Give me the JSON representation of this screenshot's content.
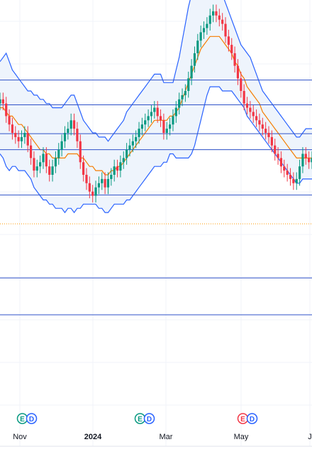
{
  "chart_data": {
    "type": "candlestick",
    "title": "",
    "x_ticks": [
      {
        "label": "Nov",
        "bold": false
      },
      {
        "label": "2024",
        "bold": true
      },
      {
        "label": "Mar",
        "bold": false
      },
      {
        "label": "May",
        "bold": false
      },
      {
        "label": "J",
        "bold": false
      }
    ],
    "ylim": [
      0,
      100
    ],
    "grid": true,
    "colors": {
      "up": "#089981",
      "down": "#f23645",
      "band": "#2962ff",
      "band_fill": "#eef4fc",
      "ma": "#f57c00",
      "hline": "#2f52c8",
      "grid": "#f0f3fa",
      "dotted": "#ff9800"
    },
    "levels": [
      82.6,
      76.7,
      69.8,
      66.0,
      55.2
    ],
    "lower_levels": [
      35.4,
      26.6
    ],
    "dotted_level": 48.3,
    "closes": [
      78,
      77,
      74,
      72,
      70,
      69,
      68,
      69,
      70,
      67,
      64,
      61,
      62,
      63,
      65,
      62,
      60,
      62,
      64,
      66,
      68,
      70,
      71,
      73,
      71,
      68,
      63,
      60,
      58,
      56,
      55,
      57,
      58,
      59,
      57,
      59,
      60,
      62,
      61,
      63,
      64,
      66,
      67,
      68,
      69,
      71,
      72,
      73,
      74,
      75,
      76,
      74,
      73,
      70,
      71,
      72,
      74,
      76,
      78,
      79,
      80,
      83,
      86,
      89,
      92,
      94,
      95,
      96,
      98,
      99,
      98,
      97,
      96,
      93,
      91,
      89,
      86,
      83,
      80,
      77,
      76,
      75,
      74,
      73,
      72,
      71,
      70,
      69,
      67,
      65,
      64,
      62,
      61,
      60,
      59,
      58,
      59,
      62,
      65,
      64,
      63,
      64
    ],
    "bollinger": {
      "upper": [
        87,
        88,
        89,
        87,
        85,
        84,
        83,
        82,
        81,
        80,
        80,
        79,
        79,
        78,
        78,
        77,
        77,
        76,
        76,
        76,
        76,
        77,
        78,
        79,
        79,
        77,
        75,
        73,
        72,
        71,
        70,
        70,
        69,
        69,
        69,
        68,
        69,
        70,
        71,
        72,
        73,
        75,
        76,
        77,
        78,
        79,
        80,
        81,
        82,
        83,
        84,
        84,
        84,
        82,
        82,
        82,
        82,
        85,
        88,
        92,
        96,
        100,
        103,
        104,
        105,
        106,
        106,
        106,
        106,
        106,
        105,
        104,
        103,
        101,
        99,
        97,
        95,
        93,
        91,
        90,
        89,
        88,
        86,
        84,
        82,
        80,
        79,
        78,
        77,
        76,
        75,
        74,
        73,
        72,
        71,
        70,
        69,
        69,
        70,
        71,
        71,
        71
      ],
      "middle": [
        76,
        76,
        75,
        74,
        74,
        73,
        72,
        72,
        71,
        70,
        69,
        68,
        67,
        66,
        66,
        65,
        65,
        64,
        64,
        64,
        64,
        64,
        65,
        65,
        65,
        65,
        64,
        64,
        63,
        62,
        62,
        61,
        61,
        61,
        60,
        60,
        61,
        61,
        62,
        62,
        63,
        64,
        65,
        66,
        67,
        68,
        69,
        70,
        71,
        72,
        73,
        73,
        73,
        73,
        73,
        74,
        74,
        75,
        76,
        78,
        80,
        82,
        84,
        86,
        88,
        90,
        91,
        92,
        93,
        93,
        93,
        93,
        92,
        91,
        90,
        89,
        87,
        86,
        84,
        83,
        81,
        80,
        79,
        78,
        77,
        75,
        74,
        73,
        72,
        71,
        70,
        69,
        68,
        67,
        66,
        65,
        64,
        64,
        64,
        64,
        64,
        64
      ],
      "lower": [
        65,
        64,
        62,
        61,
        62,
        62,
        61,
        61,
        61,
        60,
        59,
        57,
        56,
        55,
        54,
        54,
        53,
        53,
        52,
        52,
        52,
        51,
        52,
        52,
        51,
        52,
        52,
        53,
        53,
        53,
        53,
        53,
        52,
        52,
        51,
        51,
        52,
        53,
        53,
        53,
        53,
        54,
        54,
        55,
        56,
        57,
        58,
        59,
        60,
        61,
        62,
        62,
        62,
        63,
        63,
        65,
        65,
        64,
        64,
        64,
        64,
        64,
        65,
        67,
        70,
        73,
        76,
        79,
        81,
        81,
        81,
        81,
        80,
        80,
        80,
        80,
        79,
        78,
        77,
        76,
        74,
        73,
        72,
        71,
        70,
        69,
        68,
        67,
        66,
        65,
        64,
        63,
        62,
        61,
        60,
        59,
        58,
        58,
        59,
        59,
        59,
        59
      ]
    },
    "earnings_markers": [
      {
        "letters": [
          "E",
          "D"
        ],
        "color": "#089981"
      },
      {
        "letters": [
          "E",
          "D"
        ],
        "color": "#089981"
      },
      {
        "letters": [
          "E",
          "D"
        ],
        "color": "#f23645"
      }
    ]
  }
}
